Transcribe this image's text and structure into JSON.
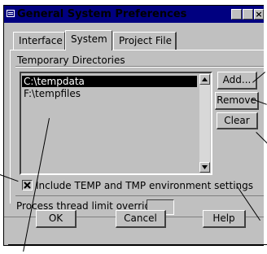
{
  "window": {
    "title": "General System Preferences"
  },
  "tabs": [
    {
      "label": "Interface"
    },
    {
      "label": "System"
    },
    {
      "label": "Project File"
    }
  ],
  "group": {
    "label": "Temporary Directories"
  },
  "directories": [
    "C:\\tempdata",
    "F:\\tempfiles"
  ],
  "side_buttons": {
    "add": "Add...",
    "remove": "Remove",
    "clear": "Clear"
  },
  "checkbox": {
    "label": "Include TEMP and TMP environment settings",
    "checked": true
  },
  "thread": {
    "label": "Process thread limit override",
    "value": ""
  },
  "footer": {
    "ok": "OK",
    "cancel": "Cancel",
    "help": "Help"
  }
}
